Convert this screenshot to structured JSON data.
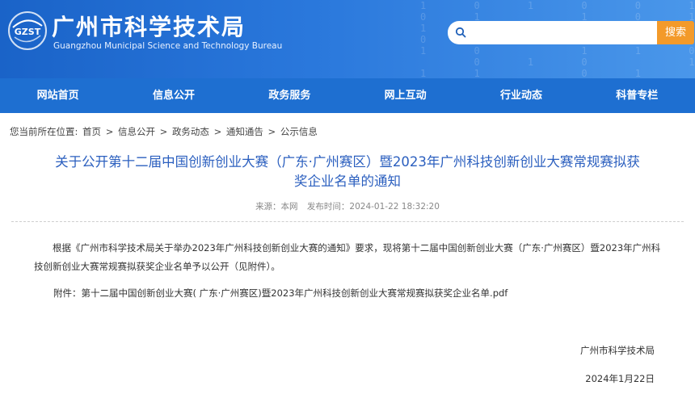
{
  "header": {
    "logo_text": "GZST",
    "title": "广州市科学技术局",
    "subtitle": "Guangzhou Municipal Science and Technology Bureau",
    "search": {
      "placeholder": "",
      "button_label": "搜索"
    }
  },
  "nav": {
    "items": [
      "网站首页",
      "信息公开",
      "政务服务",
      "网上互动",
      "行业动态",
      "科普专栏"
    ]
  },
  "breadcrumb": {
    "prefix": "您当前所在位置:",
    "items": [
      "首页",
      "信息公开",
      "政务动态",
      "通知通告",
      "公示信息"
    ],
    "separator": ">"
  },
  "article": {
    "title": "关于公开第十二届中国创新创业大赛（广东·广州赛区）暨2023年广州科技创新创业大赛常规赛拟获奖企业名单的通知",
    "source": "来源：本网",
    "published": "发布时间：2024-01-22 18:32:20",
    "body": "根据《广州市科学技术局关于举办2023年广州科技创新创业大赛的通知》要求，现将第十二届中国创新创业大赛（广东·广州赛区）暨2023年广州科技创新创业大赛常规赛拟获奖企业名单予以公开（见附件）。",
    "attachment_label": "附件：",
    "attachment_name": "第十二届中国创新创业大赛( 广东·广州赛区)暨2023年广州科技创新创业大赛常规赛拟获奖企业名单.pdf",
    "signature_org": "广州市科学技术局",
    "signature_date": "2024年1月22日"
  },
  "colors": {
    "header": "#2a78dc",
    "nav": "#1e6fd1",
    "title": "#2b5fbf",
    "search_button": "#f39a2a"
  }
}
